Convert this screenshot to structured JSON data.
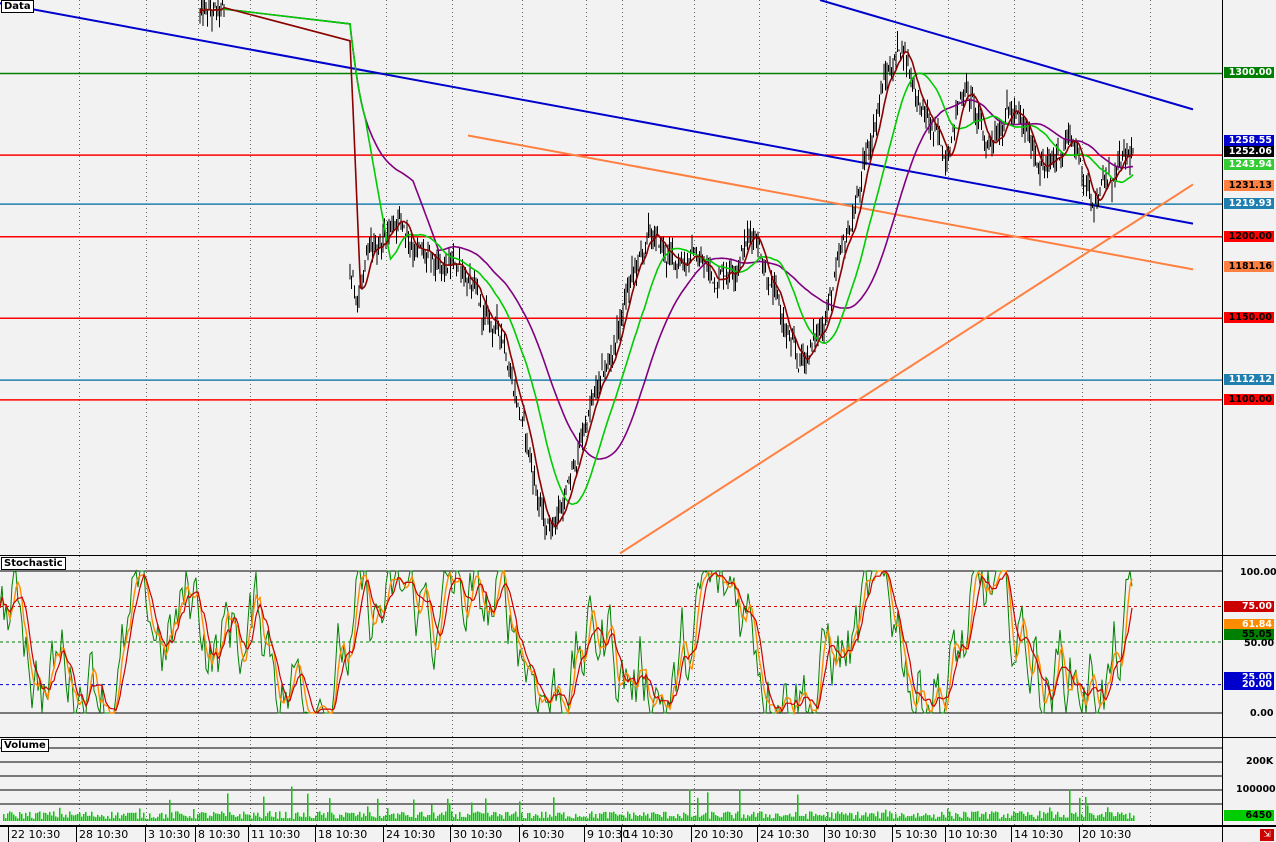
{
  "panels": {
    "price_title": "Data",
    "stoch_title": "Stochastic",
    "volume_title": "Volume"
  },
  "colors": {
    "price_bar": "#000000",
    "ma_fast": "#8b0000",
    "ma_mid": "#00cc00",
    "ma_slow": "#800080",
    "trend_blue": "#0000cc",
    "trend_orange": "#ff8040",
    "level_green": "#008000",
    "level_red": "#ff0000",
    "level_teal": "#1e7fb0",
    "stoch_k": "#008000",
    "stoch_d": "#ff8c00",
    "stoch_signal": "#cc0000",
    "volume": "#00cc00"
  },
  "price_labels": [
    {
      "text": "1300.00",
      "value": 1300.0,
      "bg": "#008000",
      "fg": "#ffffff"
    },
    {
      "text": "1258.55",
      "value": 1258.55,
      "bg": "#0000cc",
      "fg": "#ffffff"
    },
    {
      "text": "1252.06",
      "value": 1252.06,
      "bg": "#000000",
      "fg": "#ffffff"
    },
    {
      "text": "1243.94",
      "value": 1243.94,
      "bg": "#33cc33",
      "fg": "#ffffff"
    },
    {
      "text": "1231.13",
      "value": 1231.13,
      "bg": "#ff8040",
      "fg": "#000000"
    },
    {
      "text": "1219.93",
      "value": 1219.93,
      "bg": "#1e7fb0",
      "fg": "#ffffff"
    },
    {
      "text": "1200.00",
      "value": 1200.0,
      "bg": "#ff0000",
      "fg": "#000000"
    },
    {
      "text": "1181.16",
      "value": 1181.16,
      "bg": "#ff8040",
      "fg": "#000000"
    },
    {
      "text": "1150.00",
      "value": 1150.0,
      "bg": "#ff0000",
      "fg": "#000000"
    },
    {
      "text": "1112.12",
      "value": 1112.12,
      "bg": "#1e7fb0",
      "fg": "#ffffff"
    },
    {
      "text": "1100.00",
      "value": 1100.0,
      "bg": "#ff0000",
      "fg": "#000000"
    }
  ],
  "stoch_axis": [
    "100.00",
    "50.00",
    "0.00"
  ],
  "stoch_labels": [
    {
      "text": "75.00",
      "value": 75,
      "bg": "#cc0000",
      "fg": "#ffffff"
    },
    {
      "text": "61.84",
      "value": 61.84,
      "bg": "#ff8c00",
      "fg": "#ffffff"
    },
    {
      "text": "55.05",
      "value": 55.05,
      "bg": "#008000",
      "fg": "#000000"
    },
    {
      "text": "25.00",
      "value": 25,
      "bg": "#0000cc",
      "fg": "#ffffff"
    },
    {
      "text": "20.00",
      "value": 20,
      "bg": "#0000cc",
      "fg": "#ffffff"
    }
  ],
  "volume_axis": [
    "200K",
    "100000"
  ],
  "volume_last": {
    "text": "6450",
    "bg": "#00cc00",
    "fg": "#000000"
  },
  "x_labels": [
    "22 10:30",
    "28 10:30",
    "3 10:30",
    "8 10:30",
    "11 10:30",
    "18 10:30",
    "24 10:30",
    "30 10:30",
    "6 10:30",
    "9 10:30",
    "14 10:30",
    "20 10:30",
    "24 10:30",
    "30 10:30",
    "5 10:30",
    "10 10:30",
    "14 10:30",
    "20 10:30"
  ],
  "chart_data": {
    "type": "line",
    "title": "",
    "ylim": [
      1005,
      1345
    ],
    "levels": [
      1300,
      1250,
      1219.93,
      1200,
      1150,
      1112.12,
      1100
    ],
    "price_anchors": [
      [
        0,
        1340
      ],
      [
        3,
        1335
      ],
      [
        5.6,
        1335
      ],
      [
        6,
        1340
      ],
      [
        6.3,
        1300
      ],
      [
        6.7,
        1200
      ],
      [
        7.0,
        1125
      ],
      [
        7.3,
        1160
      ],
      [
        8.0,
        1190
      ],
      [
        8.5,
        1165
      ],
      [
        9.0,
        1195
      ],
      [
        9.5,
        1215
      ],
      [
        10.0,
        1190
      ],
      [
        10.5,
        1175
      ],
      [
        11.0,
        1185
      ],
      [
        11.5,
        1150
      ],
      [
        12.0,
        1140
      ],
      [
        12.5,
        1080
      ],
      [
        13.0,
        1020
      ],
      [
        13.5,
        1040
      ],
      [
        14.0,
        1090
      ],
      [
        14.5,
        1120
      ],
      [
        15.0,
        1170
      ],
      [
        15.5,
        1200
      ],
      [
        16.0,
        1185
      ],
      [
        16.5,
        1190
      ],
      [
        17.0,
        1175
      ],
      [
        17.5,
        1185
      ],
      [
        18.0,
        1205
      ],
      [
        18.5,
        1160
      ],
      [
        19.0,
        1120
      ],
      [
        19.5,
        1140
      ],
      [
        20.0,
        1180
      ],
      [
        20.5,
        1230
      ],
      [
        21.0,
        1290
      ],
      [
        21.5,
        1320
      ],
      [
        22.0,
        1275
      ],
      [
        22.5,
        1250
      ],
      [
        23.0,
        1295
      ],
      [
        23.5,
        1255
      ],
      [
        24.0,
        1280
      ],
      [
        24.5,
        1260
      ],
      [
        25.0,
        1240
      ],
      [
        25.5,
        1265
      ],
      [
        26.0,
        1225
      ],
      [
        26.5,
        1235
      ],
      [
        27.0,
        1250
      ]
    ],
    "stoch": {
      "axis": [
        0,
        100
      ],
      "overbought": 75,
      "oversold": 25
    },
    "volume": {
      "axis": [
        0,
        250000
      ]
    }
  }
}
